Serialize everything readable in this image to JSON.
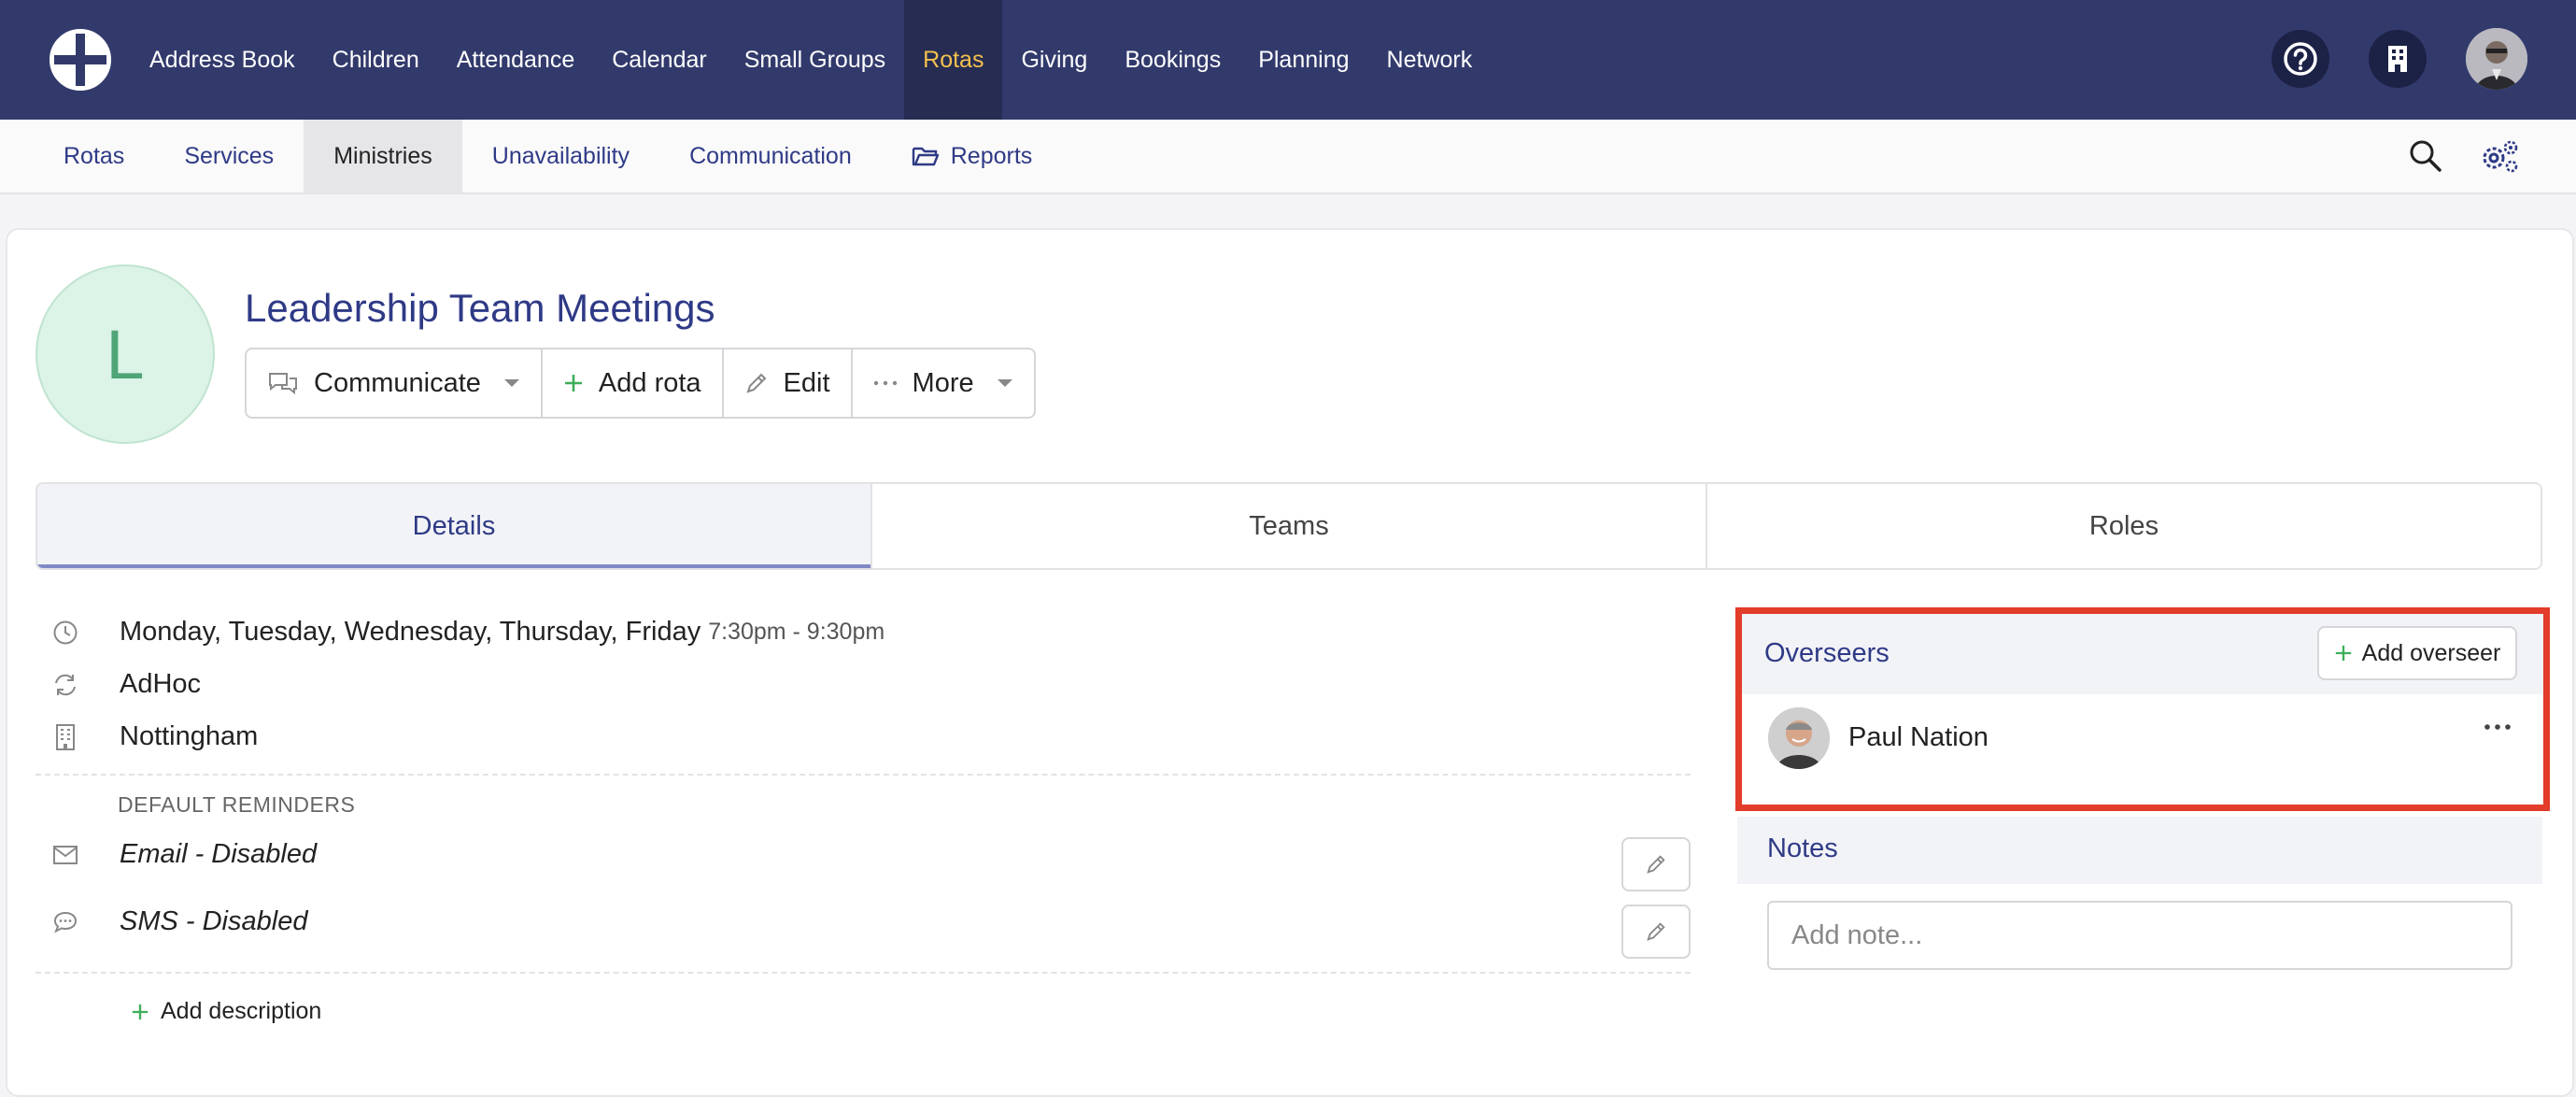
{
  "topnav": {
    "items": [
      {
        "label": "Address Book"
      },
      {
        "label": "Children"
      },
      {
        "label": "Attendance"
      },
      {
        "label": "Calendar"
      },
      {
        "label": "Small Groups"
      },
      {
        "label": "Rotas",
        "active": true
      },
      {
        "label": "Giving"
      },
      {
        "label": "Bookings"
      },
      {
        "label": "Planning"
      },
      {
        "label": "Network"
      }
    ],
    "icons": [
      "help-icon",
      "building-icon",
      "user-avatar"
    ]
  },
  "subnav": {
    "items": [
      {
        "label": "Rotas"
      },
      {
        "label": "Services"
      },
      {
        "label": "Ministries",
        "active": true
      },
      {
        "label": "Unavailability"
      },
      {
        "label": "Communication"
      },
      {
        "label": "Reports",
        "icon": "folder-open-icon"
      }
    ],
    "icons": [
      "search-icon",
      "settings-icon"
    ]
  },
  "ministry": {
    "initial": "L",
    "title": "Leadership Team Meetings",
    "actions": {
      "communicate": "Communicate",
      "add_rota": "Add rota",
      "edit": "Edit",
      "more": "More"
    }
  },
  "tabs": [
    {
      "label": "Details",
      "active": true
    },
    {
      "label": "Teams"
    },
    {
      "label": "Roles"
    }
  ],
  "details": {
    "days": "Monday, Tuesday, Wednesday, Thursday, Friday",
    "time": "7:30pm - 9:30pm",
    "frequency": "AdHoc",
    "location": "Nottingham",
    "reminders_label": "DEFAULT REMINDERS",
    "email": "Email - Disabled",
    "sms": "SMS - Disabled",
    "add_description": "Add description"
  },
  "overseers": {
    "title": "Overseers",
    "add_label": "Add overseer",
    "people": [
      {
        "name": "Paul Nation"
      }
    ]
  },
  "notes": {
    "title": "Notes",
    "placeholder": "Add note..."
  },
  "colors": {
    "nav_bg": "#323a6c",
    "nav_active_text": "#f4c14e",
    "accent": "#2f3a86",
    "highlight": "#e23c2a",
    "plus_green": "#3fae5a"
  }
}
